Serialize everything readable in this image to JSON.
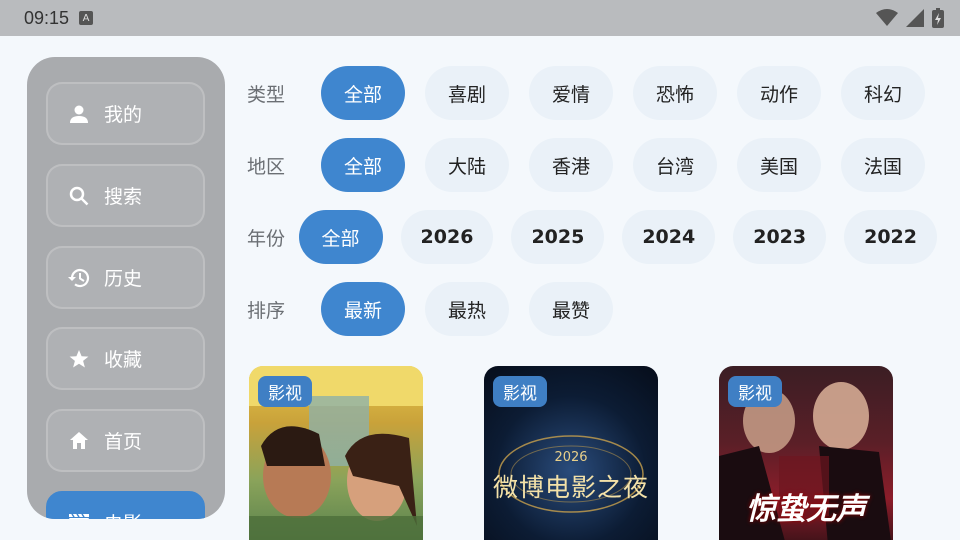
{
  "status_bar": {
    "time": "09:15",
    "a_indicator": "A"
  },
  "sidebar": {
    "items": [
      {
        "label": "我的",
        "icon": "person-icon"
      },
      {
        "label": "搜索",
        "icon": "search-icon"
      },
      {
        "label": "历史",
        "icon": "history-icon"
      },
      {
        "label": "收藏",
        "icon": "star-icon"
      },
      {
        "label": "首页",
        "icon": "home-icon"
      },
      {
        "label": "电影",
        "icon": "movie-icon",
        "active": true
      }
    ]
  },
  "filters": [
    {
      "label": "类型",
      "options": [
        "全部",
        "喜剧",
        "爱情",
        "恐怖",
        "动作",
        "科幻"
      ],
      "selected": "全部"
    },
    {
      "label": "地区",
      "options": [
        "全部",
        "大陆",
        "香港",
        "台湾",
        "美国",
        "法国"
      ],
      "selected": "全部"
    },
    {
      "label": "年份",
      "options": [
        "全部",
        "2026",
        "2025",
        "2024",
        "2023",
        "2022"
      ],
      "selected": "全部"
    },
    {
      "label": "排序",
      "options": [
        "最新",
        "最热",
        "最赞"
      ],
      "selected": "最新"
    }
  ],
  "cards": [
    {
      "badge": "影视"
    },
    {
      "badge": "影视",
      "poster_text": "微博电影之夜",
      "poster_year": "2026"
    },
    {
      "badge": "影视",
      "poster_text": "惊蛰无声"
    }
  ],
  "colors": {
    "accent": "#3f86cf",
    "chip_bg": "#eaf1f8",
    "sidebar_bg": "#a9abae"
  }
}
